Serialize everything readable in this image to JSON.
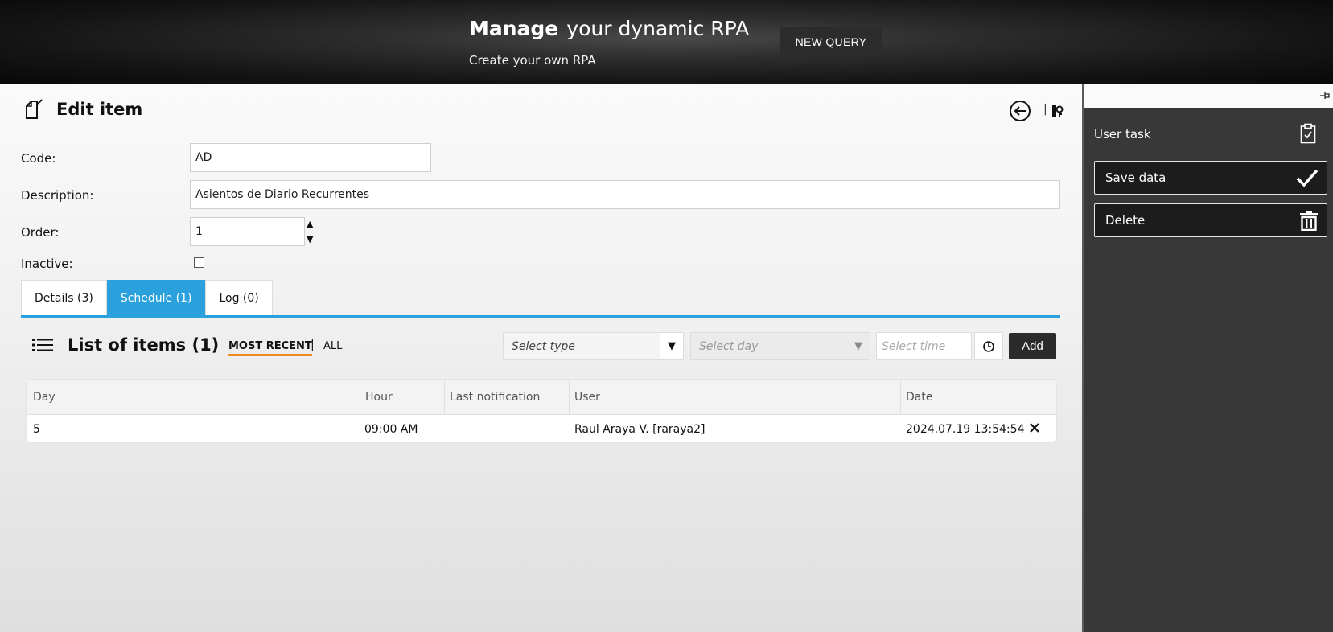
{
  "header": {
    "title_bold": "Manage",
    "title_rest": "your dynamic RPA",
    "subtitle": "Create your own RPA",
    "new_query_label": "NEW QUERY"
  },
  "edit": {
    "title": "Edit item",
    "separator": "|"
  },
  "form": {
    "code_label": "Code:",
    "code_value": "AD",
    "description_label": "Description:",
    "description_value": "Asientos de Diario Recurrentes",
    "order_label": "Order:",
    "order_value": "1",
    "inactive_label": "Inactive:",
    "inactive_checked": false
  },
  "tabs": [
    {
      "label": "Details (3)",
      "active": false
    },
    {
      "label": "Schedule (1)",
      "active": true
    },
    {
      "label": "Log (0)",
      "active": false
    }
  ],
  "list": {
    "title": "List of items (1)",
    "filter_recent": "MOST RECENT",
    "filter_sep": "|",
    "filter_all": "ALL",
    "select_type_placeholder": "Select type",
    "select_day_placeholder": "Select day",
    "select_time_placeholder": "Select time",
    "add_label": "Add"
  },
  "table": {
    "columns": [
      "Day",
      "Hour",
      "Last notification",
      "User",
      "Date"
    ],
    "rows": [
      {
        "day": "5",
        "hour": "09:00 AM",
        "last_notification": "",
        "user": "Raul Araya V. [raraya2]",
        "date": "2024.07.19 13:54:54"
      }
    ]
  },
  "sidebar": {
    "title": "User task",
    "save_label": "Save data",
    "delete_label": "Delete"
  },
  "colors": {
    "accent": "#2aa1dc",
    "filter_underline": "#f08a24",
    "sidebar_bg": "#383838"
  }
}
